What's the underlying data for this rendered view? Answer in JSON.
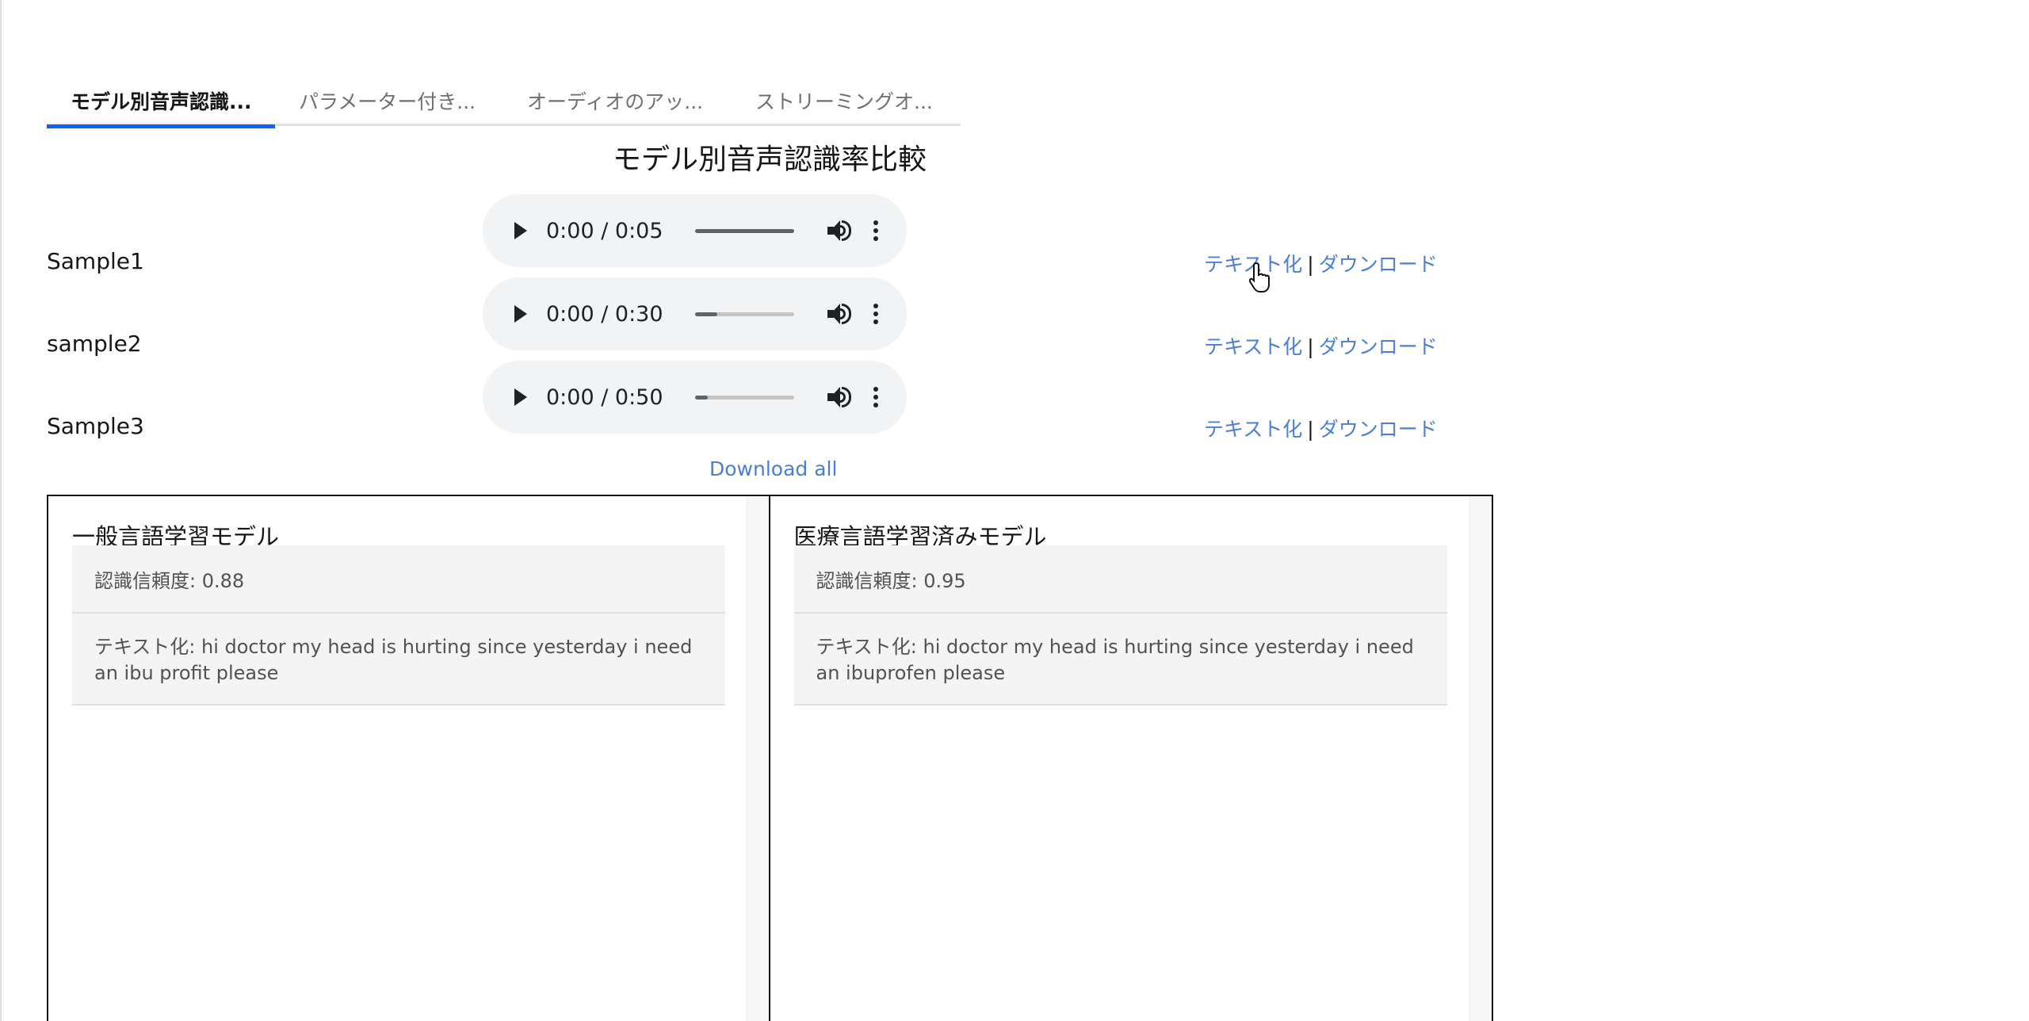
{
  "tabs": [
    {
      "label": "モデル別音声認識...",
      "active": true
    },
    {
      "label": "パラメーター付き...",
      "active": false
    },
    {
      "label": "オーディオのアッ...",
      "active": false
    },
    {
      "label": "ストリーミングオ...",
      "active": false
    }
  ],
  "page_title": "モデル別音声認識率比較",
  "samples": [
    {
      "label": "Sample1",
      "time": "0:00 / 0:05",
      "progress": 1.0
    },
    {
      "label": "sample2",
      "time": "0:00 / 0:30",
      "progress": 0.22
    },
    {
      "label": "Sample3",
      "time": "0:00 / 0:50",
      "progress": 0.13
    }
  ],
  "links": {
    "transcribe": "テキスト化",
    "separator": "|",
    "download": "ダウンロード"
  },
  "download_all": "Download all",
  "panels": [
    {
      "title": "一般言語学習モデル",
      "confidence": "認識信頼度: 0.88",
      "text": "テキスト化: hi doctor my head is hurting since yesterday i need an ibu profit please"
    },
    {
      "title": "医療言語学習済みモデル",
      "confidence": "認識信頼度: 0.95",
      "text": "テキスト化: hi doctor my head is hurting since yesterday i need an ibuprofen please"
    }
  ],
  "colors": {
    "accent": "#0f62fe",
    "link": "#4a7fd4",
    "player_bg": "#f1f3f4",
    "card_bg": "#f4f4f4"
  }
}
